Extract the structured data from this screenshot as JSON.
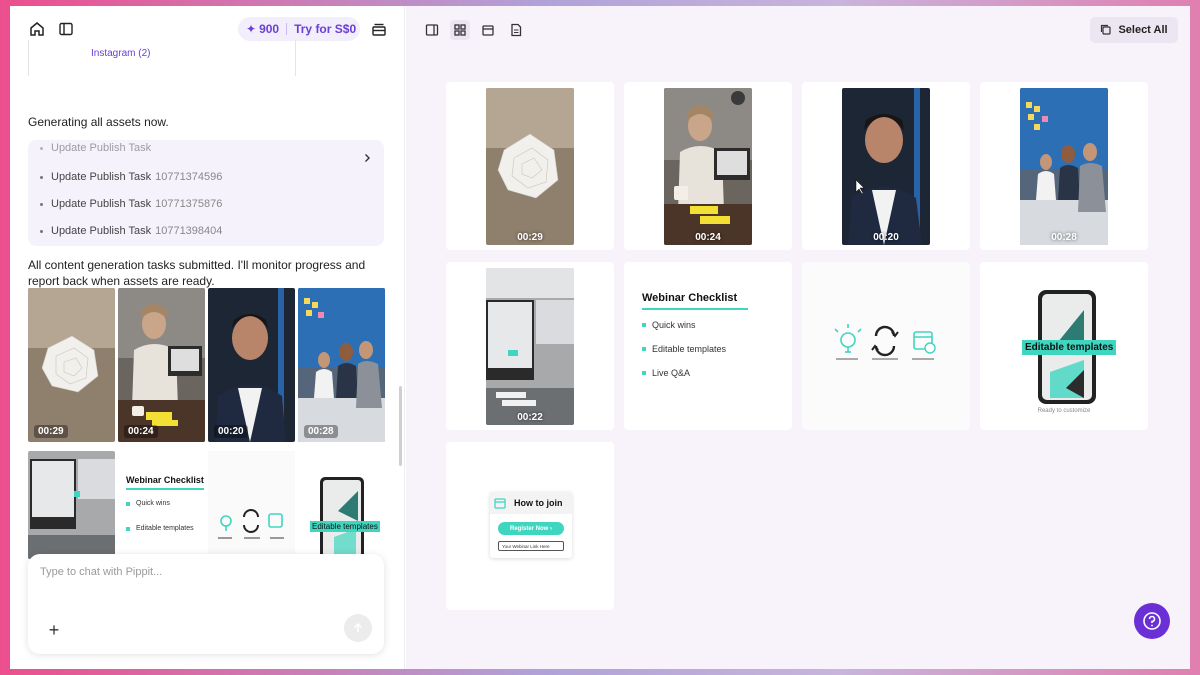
{
  "topbar": {
    "credits_count": "900",
    "try_label": "Try for S$0"
  },
  "chat": {
    "instagram_label": "Instagram (2)",
    "generating_text": "Generating all assets now.",
    "tasks": [
      {
        "label": "Update Publish Task",
        "id": "10771374596"
      },
      {
        "label": "Update Publish Task",
        "id": "10771375876"
      },
      {
        "label": "Update Publish Task",
        "id": "10771398404"
      }
    ],
    "submitted_text": "All content generation tasks submitted. I'll monitor progress and report back when assets are ready.",
    "thumbs": [
      {
        "duration": "00:29"
      },
      {
        "duration": "00:24"
      },
      {
        "duration": "00:20"
      },
      {
        "duration": "00:28"
      }
    ],
    "left_checklist": {
      "title": "Webinar Checklist",
      "items": [
        "Quick wins",
        "Editable templates"
      ]
    },
    "left_editable": "Editable templates",
    "input_placeholder": "Type to chat with Pippit..."
  },
  "canvas": {
    "select_all_label": "Select All",
    "videos": [
      {
        "duration": "00:29"
      },
      {
        "duration": "00:24"
      },
      {
        "duration": "00:20"
      },
      {
        "duration": "00:28"
      },
      {
        "duration": "00:22"
      }
    ],
    "checklist": {
      "title": "Webinar Checklist",
      "items": [
        "Quick wins",
        "Editable templates",
        "Live Q&A"
      ]
    },
    "editable_label": "Editable templates",
    "editable_caption": "Ready to customize",
    "howto": {
      "title": "How to join",
      "button": "Register Now",
      "link": "Your Webinar Link Here"
    }
  },
  "colors": {
    "accent": "#6b3fd6",
    "teal": "#3fd6c0"
  }
}
